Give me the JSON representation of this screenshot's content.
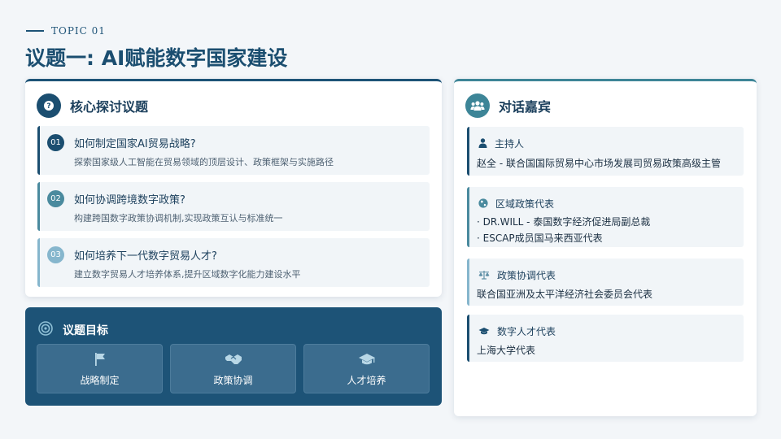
{
  "header": {
    "topic_label": "TOPIC 01",
    "title": "议题一: AI赋能数字国家建设"
  },
  "core_topics": {
    "title": "核心探讨议题",
    "icon": "question-icon",
    "items": [
      {
        "num": "01",
        "title": "如何制定国家AI贸易战略?",
        "desc": "探索国家级人工智能在贸易领域的顶层设计、政策框架与实施路径"
      },
      {
        "num": "02",
        "title": "如何协调跨境数字政策?",
        "desc": "构建跨国数字政策协调机制,实现政策互认与标准统一"
      },
      {
        "num": "03",
        "title": "如何培养下一代数字贸易人才?",
        "desc": "建立数字贸易人才培养体系,提升区域数字化能力建设水平"
      }
    ]
  },
  "goals": {
    "title": "议题目标",
    "icon": "target-icon",
    "items": [
      {
        "label": "战略制定",
        "icon": "flag-icon"
      },
      {
        "label": "政策协调",
        "icon": "handshake-icon"
      },
      {
        "label": "人才培养",
        "icon": "graduation-cap-icon"
      }
    ]
  },
  "guests": {
    "title": "对话嘉宾",
    "icon": "users-icon",
    "items": [
      {
        "role": "主持人",
        "icon": "user-icon",
        "lines": [
          "赵全 - 联合国国际贸易中心市场发展司贸易政策高级主管"
        ]
      },
      {
        "role": "区域政策代表",
        "icon": "globe-icon",
        "lines": [
          "· DR.WILL - 泰国数字经济促进局副总裁",
          "· ESCAP成员国马来西亚代表"
        ]
      },
      {
        "role": "政策协调代表",
        "icon": "balance-scale-icon",
        "lines": [
          "联合国亚洲及太平洋经济社会委员会代表"
        ]
      },
      {
        "role": "数字人才代表",
        "icon": "graduation-cap-icon",
        "lines": [
          "上海大学代表"
        ]
      }
    ]
  },
  "colors": {
    "primary": "#1b4e70",
    "teal": "#3d8597",
    "goal_bg": "#1d5377",
    "background": "#f3f6f9"
  }
}
